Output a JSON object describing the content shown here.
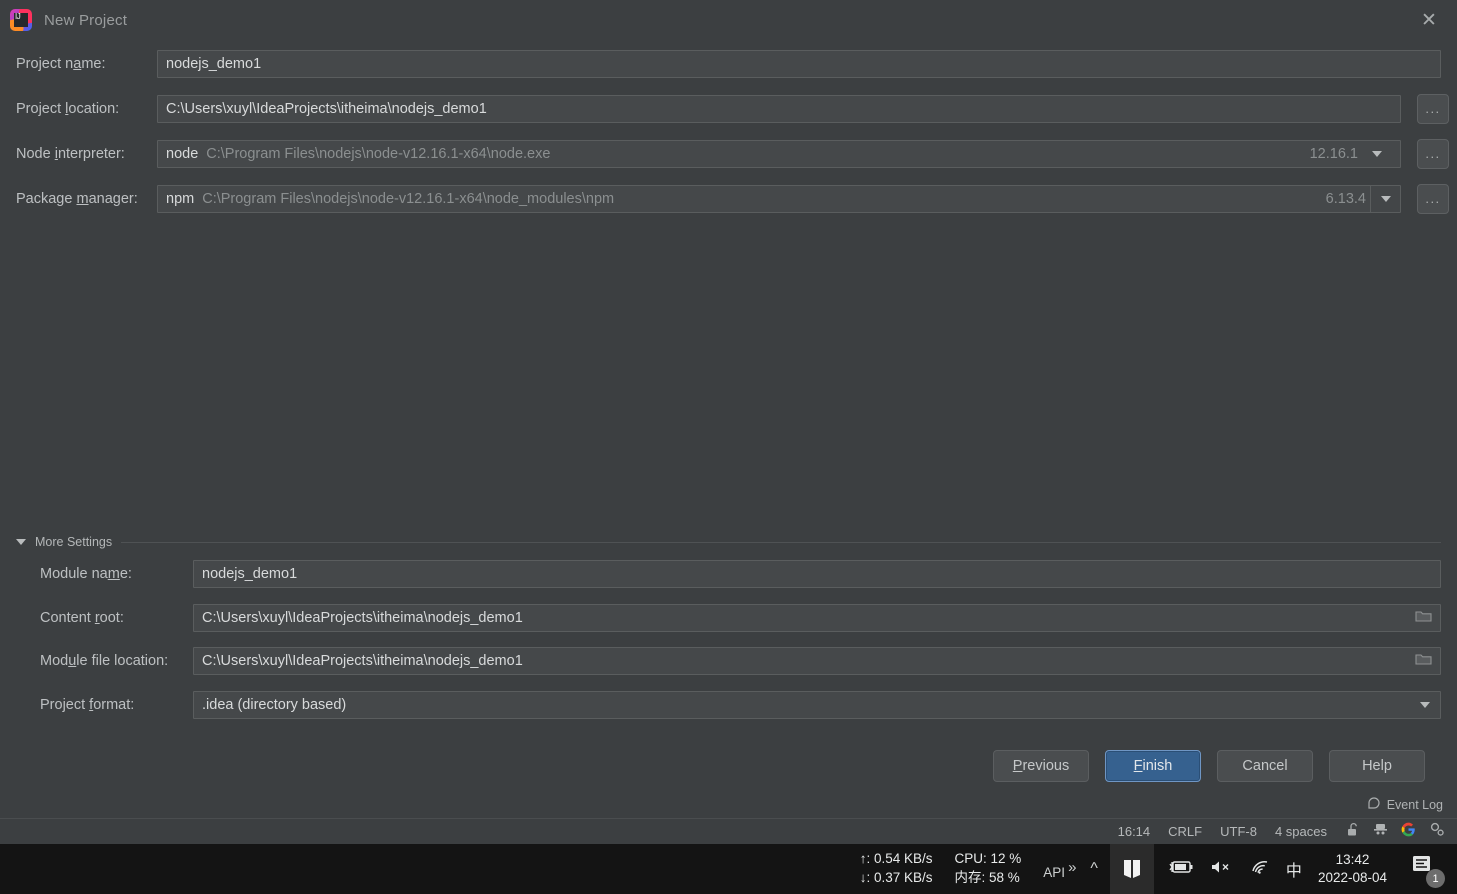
{
  "window": {
    "title": "New Project",
    "logo_icon": "intellij-idea-logo",
    "close_icon": "close-icon"
  },
  "form": {
    "fields": [
      {
        "label_pre": "Project n",
        "label_accel": "a",
        "label_post": "me:",
        "value": "nodejs_demo1",
        "name": "project-name"
      },
      {
        "label_pre": "Project ",
        "label_accel": "l",
        "label_post": "ocation:",
        "value": "C:\\Users\\xuyl\\IdeaProjects\\itheima\\nodejs_demo1",
        "name": "project-location"
      },
      {
        "label_pre": "Node ",
        "label_accel": "i",
        "label_post": "nterpreter:",
        "prefix": "node",
        "value": "C:\\Program Files\\nodejs\\node-v12.16.1-x64\\node.exe",
        "version": "12.16.1",
        "name": "node-interpreter"
      },
      {
        "label_pre": "Package ",
        "label_accel": "m",
        "label_post": "anager:",
        "prefix": "npm",
        "value": "C:\\Program Files\\nodejs\\node-v12.16.1-x64\\node_modules\\npm",
        "version": "6.13.4",
        "name": "package-manager"
      }
    ],
    "browse_dots": "...",
    "browse_title": "Browse"
  },
  "more_settings": {
    "label": "More Settings",
    "expanded": true,
    "fields": [
      {
        "label_pre": "Module na",
        "label_accel": "m",
        "label_post": "e:",
        "value": "nodejs_demo1",
        "name": "module-name"
      },
      {
        "label_pre": "Content ",
        "label_accel": "r",
        "label_post": "oot:",
        "value": "C:\\Users\\xuyl\\IdeaProjects\\itheima\\nodejs_demo1",
        "name": "content-root"
      },
      {
        "label_pre": "Mod",
        "label_accel": "u",
        "label_post": "le file location:",
        "value": "C:\\Users\\xuyl\\IdeaProjects\\itheima\\nodejs_demo1",
        "name": "module-file-location"
      },
      {
        "label_pre": "Project ",
        "label_accel": "f",
        "label_post": "ormat:",
        "value": ".idea (directory based)",
        "name": "project-format"
      }
    ]
  },
  "buttons": {
    "previous_pre": "",
    "previous_accel": "P",
    "previous_post": "revious",
    "finish_pre": "",
    "finish_accel": "F",
    "finish_post": "inish",
    "cancel": "Cancel",
    "help": "Help"
  },
  "ide_status": {
    "event_log": "Event Log",
    "event_log_icon": "event-log-icon",
    "caret_position": "16:14",
    "line_separator": "CRLF",
    "encoding": "UTF-8",
    "indent": "4 spaces",
    "lock_icon": "unlocked-padlock-icon",
    "inspector_icon": "inspector-hat-icon",
    "google_icon": "google-icon",
    "settings_icon": "settings-gear-icon"
  },
  "taskbar": {
    "upload_speed": "↑: 0.54 KB/s",
    "download_speed": "↓: 0.37 KB/s",
    "cpu": "CPU: 12 %",
    "memory": "内存: 58 %",
    "api_label": "API",
    "overflow_chevron": "»",
    "show_hidden_icons": "^",
    "battery_icon": "battery-charging-icon",
    "volume_icon": "volume-muted-icon",
    "wifi_icon": "wifi-icon",
    "ime_label": "中",
    "clock_time": "13:42",
    "clock_date": "2022-08-04",
    "notification_icon": "notification-icon",
    "notification_count": "1"
  },
  "colors": {
    "dialog_bg": "#3c3f41",
    "field_bg": "#45484a",
    "accent_blue": "#36618f",
    "taskbar_bg": "#141414"
  }
}
